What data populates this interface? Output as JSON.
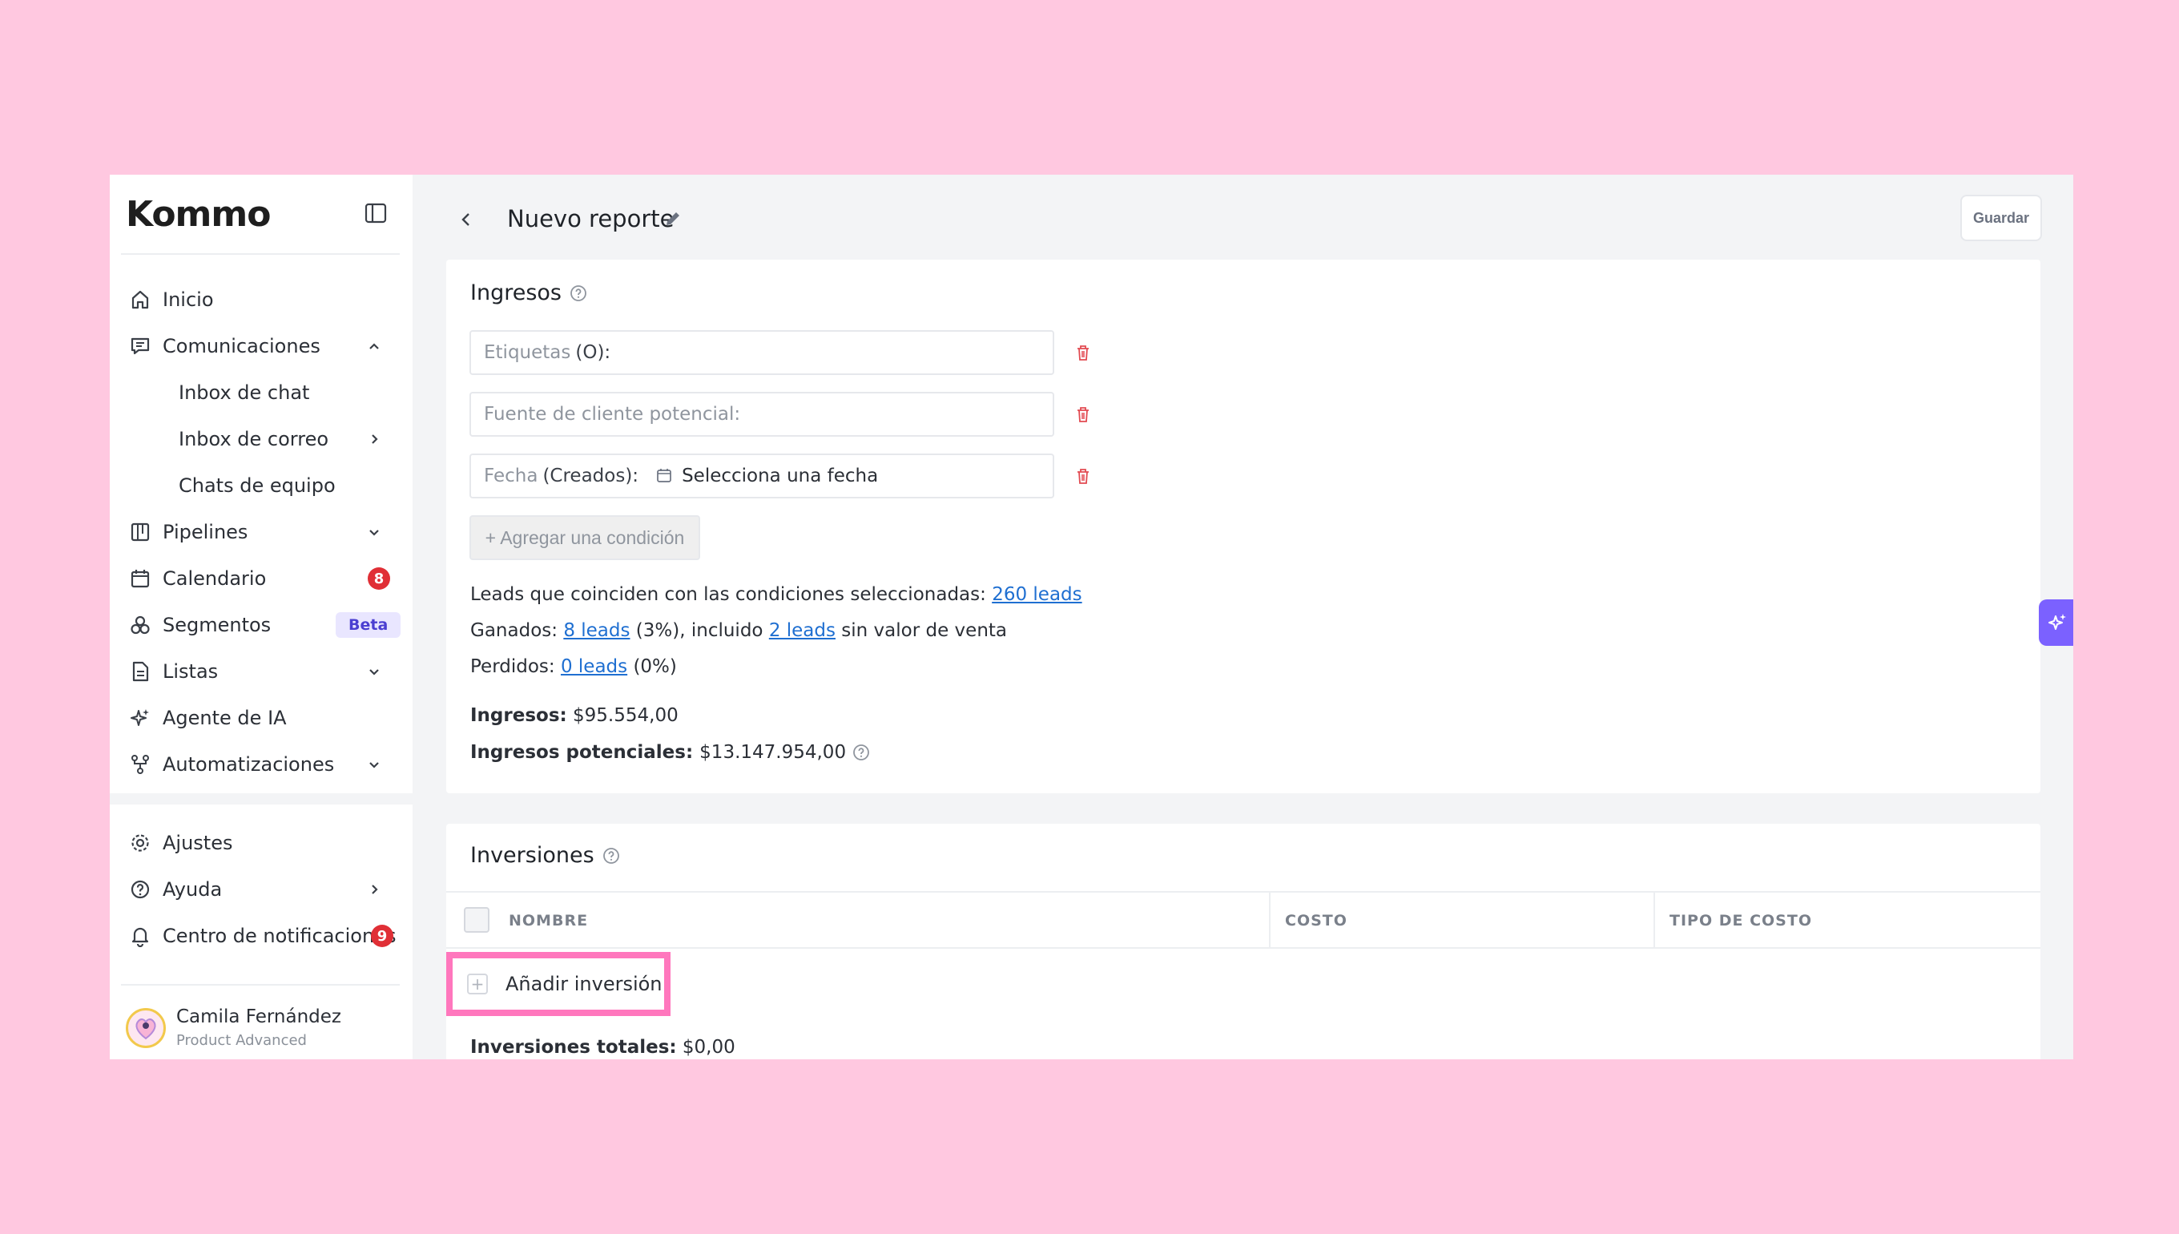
{
  "brand": {
    "logo_text": "Kommo"
  },
  "sidebar": {
    "items": [
      {
        "label": "Inicio",
        "icon": "home-icon"
      },
      {
        "label": "Comunicaciones",
        "icon": "chat-icon",
        "expanded": true
      },
      {
        "label": "Inbox de chat"
      },
      {
        "label": "Inbox de correo"
      },
      {
        "label": "Chats de equipo"
      },
      {
        "label": "Pipelines",
        "icon": "pipelines-icon"
      },
      {
        "label": "Calendario",
        "icon": "calendar-icon",
        "badge": "8"
      },
      {
        "label": "Segmentos",
        "icon": "segments-icon",
        "badge": "Beta"
      },
      {
        "label": "Listas",
        "icon": "lists-icon"
      },
      {
        "label": "Agente de IA",
        "icon": "sparkles-icon"
      },
      {
        "label": "Automatizaciones",
        "icon": "automation-icon"
      }
    ],
    "bottom_items": [
      {
        "label": "Ajustes",
        "icon": "gear-icon"
      },
      {
        "label": "Ayuda",
        "icon": "help-icon"
      },
      {
        "label": "Centro de notificaciones",
        "icon": "bell-icon",
        "badge": "9"
      }
    ],
    "profile": {
      "name": "Camila Fernández",
      "plan": "Product Advanced"
    }
  },
  "header": {
    "title": "Nuevo reporte",
    "save_label": "Guardar"
  },
  "ingresos": {
    "title": "Ingresos",
    "fields": [
      {
        "placeholder": "Etiquetas",
        "suffix": "(O):"
      },
      {
        "placeholder": "Fuente de cliente potencial:",
        "suffix": ""
      },
      {
        "placeholder": "Fecha",
        "suffix": "(Creados):",
        "value": "Selecciona una fecha"
      }
    ],
    "add_condition": "+ Agregar una condición",
    "summary": {
      "matching_prefix": "Leads que coinciden con las condiciones seleccionadas:",
      "matching_link": "260 leads",
      "won_prefix": "Ganados:",
      "won_link": "8 leads",
      "won_pct": "(3%), incluido",
      "won_link2": "2 leads",
      "won_suffix": "sin valor de venta",
      "lost_prefix": "Perdidos:",
      "lost_link": "0 leads",
      "lost_pct": "(0%)",
      "revenue_label": "Ingresos:",
      "revenue_value": "$95.554,00",
      "potential_label": "Ingresos potenciales:",
      "potential_value": "$13.147.954,00"
    }
  },
  "inversiones": {
    "title": "Inversiones",
    "columns": [
      "NOMBRE",
      "COSTO",
      "TIPO DE COSTO"
    ],
    "add_label": "Añadir inversión",
    "total_label": "Inversiones totales:",
    "total_value": "$0,00"
  },
  "colors": {
    "accent": "#7b61ff",
    "link": "#1f6fd1",
    "danger": "#e02f36",
    "highlight": "#ff77bd",
    "background": "#ffc8e0"
  }
}
